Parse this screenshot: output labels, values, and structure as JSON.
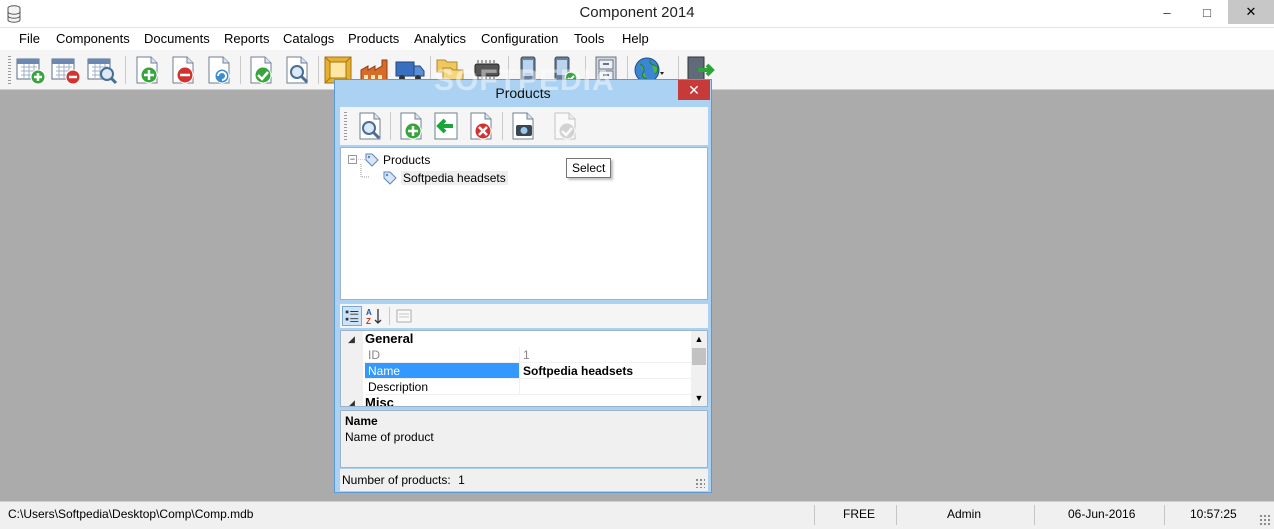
{
  "window": {
    "title": "Component 2014",
    "controls": {
      "minimize": "–",
      "maximize": "□",
      "close": "✕"
    }
  },
  "menu": [
    "File",
    "Components",
    "Documents",
    "Reports",
    "Catalogs",
    "Products",
    "Analytics",
    "Configuration",
    "Tools",
    "Help"
  ],
  "toolbar": {
    "buttons": [
      "calendar-add-icon",
      "calendar-remove-icon",
      "calendar-search-icon",
      "document-add-icon",
      "document-remove-icon",
      "document-refresh-icon",
      "document-check-icon",
      "document-search-icon",
      "catalog-frame-icon",
      "factory-icon",
      "truck-icon",
      "folders-icon",
      "chip-icon",
      "phone-icon",
      "device-check-icon",
      "cabinet-icon",
      "globe-icon",
      "exit-icon"
    ]
  },
  "watermark": "SOFTPEDIA",
  "dialog": {
    "title": "Products",
    "close": "✕",
    "toolbar": [
      "search-icon",
      "add-icon",
      "back-icon",
      "delete-icon",
      "camera-icon",
      "select-icon"
    ],
    "tooltip": "Select",
    "tree": {
      "root": "Products",
      "child": "Softpedia headsets"
    },
    "property_grid": {
      "categories": [
        {
          "name": "General",
          "rows": [
            {
              "name": "ID",
              "value": "1"
            },
            {
              "name": "Name",
              "value": "Softpedia headsets"
            },
            {
              "name": "Description",
              "value": ""
            }
          ]
        },
        {
          "name": "Misc"
        }
      ],
      "description_title": "Name",
      "description_text": "Name of product"
    },
    "status": {
      "label": "Number of products:",
      "count": "1"
    }
  },
  "statusbar": {
    "path": "C:\\Users\\Softpedia\\Desktop\\Comp\\Comp.mdb",
    "license": "FREE",
    "user": "Admin",
    "date": "06-Jun-2016",
    "time": "10:57:25"
  },
  "colors": {
    "dialog_border": "#5c9ad6",
    "dialog_frame": "#abd2f2",
    "selection": "#3399ff",
    "close_red": "#c63a3a",
    "workspace": "#ababab"
  }
}
